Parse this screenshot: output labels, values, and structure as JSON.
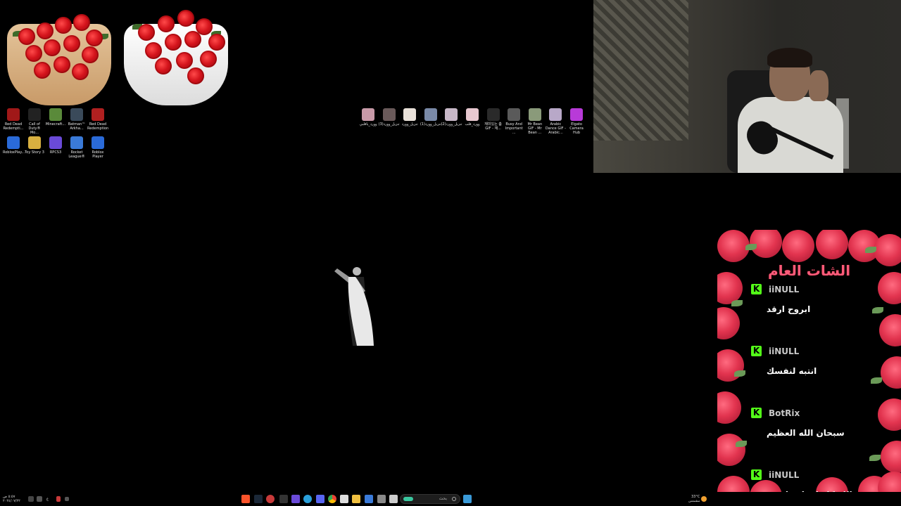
{
  "desktop": {
    "left_icons": [
      {
        "label": "Red Dead Redempti...",
        "color": "#a01818"
      },
      {
        "label": "Call of Duty® Mo...",
        "color": "#222222"
      },
      {
        "label": "Minecraft...",
        "color": "#5a8a3a"
      },
      {
        "label": "Batman™ Arkha...",
        "color": "#3a4a5a"
      },
      {
        "label": "Red Dead Redemption",
        "color": "#b02020"
      },
      {
        "label": "RobloxPlay...",
        "color": "#2a6ad8"
      },
      {
        "label": "Toy Story 3",
        "color": "#d8b040"
      },
      {
        "label": "RPCS3",
        "color": "#6a4ad8"
      },
      {
        "label": "Rocket League®",
        "color": "#3a7ad8"
      },
      {
        "label": "Roblox Player",
        "color": "#2a6ad8"
      }
    ],
    "top_icons": [
      {
        "label": "وورد_ياقلبي",
        "color": "#c89aa8"
      },
      {
        "label": "(3)تنزيل_وورد",
        "color": "#6a5a5a"
      },
      {
        "label": "تنزيل_وورد",
        "color": "#e8e0d8"
      },
      {
        "label": "(1)تنزيل_وورد",
        "color": "#7a8aa8"
      },
      {
        "label": "(2)تنزيل_وورد",
        "color": "#c8b8c8"
      },
      {
        "label": "وورد_قلب",
        "color": "#e8c8d0"
      },
      {
        "label": "재미있는 춤 GIF - 재...",
        "color": "#2a2a2a"
      },
      {
        "label": "Busy And Important ...",
        "color": "#5a5a5a"
      },
      {
        "label": "Mr Bean GIF - Mr Bean ...",
        "color": "#8a9a7a"
      },
      {
        "label": "Arabic Dance GIF - Arabic...",
        "color": "#b8a8c8"
      },
      {
        "label": "Elgato Camera Hub",
        "color": "#b83ad8"
      }
    ]
  },
  "chat": {
    "title": "الشات العام",
    "messages": [
      {
        "user": "iiNULL",
        "text": "ابروح ارقد"
      },
      {
        "user": "iiNULL",
        "text": "انتبه لنفسك"
      },
      {
        "user": "BotRix",
        "text": "سبحان الله العظيم"
      },
      {
        "user": "iiNULL",
        "text": "بس والله كابدايه اسطوريه"
      }
    ],
    "kick_letter": "K"
  },
  "taskbar": {
    "search_placeholder": "بحث",
    "weather_temp": "33°C",
    "weather_desc": "مشمس",
    "time": "٥:٥٧ ص",
    "date": "٢٠٢٤/٠٧/٢٢",
    "lang": "ع"
  },
  "colors": {
    "kick_green": "#53fc18",
    "chat_title": "#ff5b7a",
    "rose_red": "#d4141c"
  }
}
